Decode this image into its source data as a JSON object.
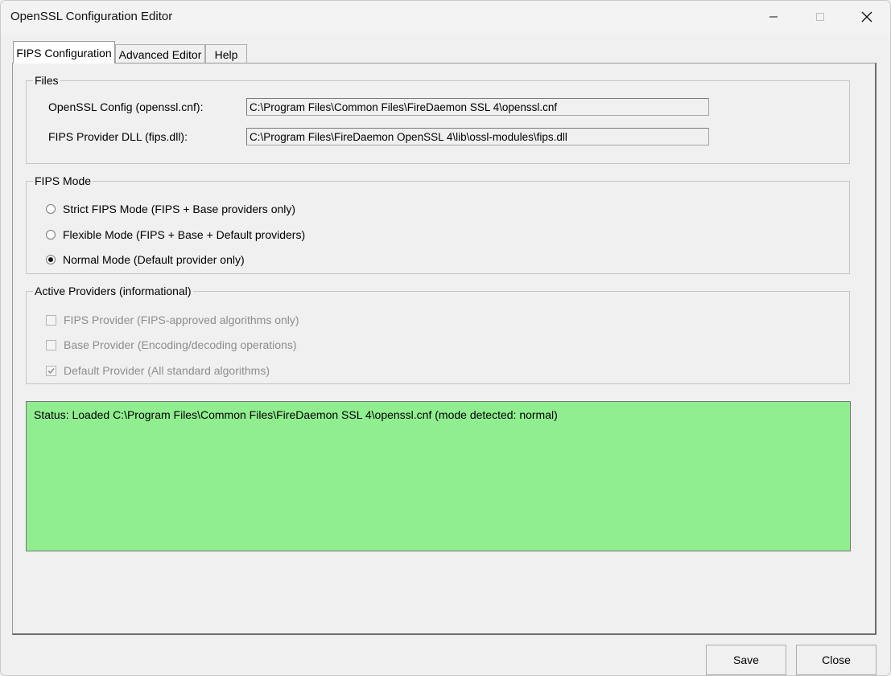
{
  "window": {
    "title": "OpenSSL Configuration Editor",
    "minimize_icon": "minimize-icon",
    "maximize_icon": "maximize-icon",
    "close_icon": "close-icon"
  },
  "tabs": [
    {
      "label": "FIPS Configuration",
      "active": true
    },
    {
      "label": "Advanced Editor",
      "active": false
    },
    {
      "label": "Help",
      "active": false
    }
  ],
  "files": {
    "title": "Files",
    "openssl_config_label": "OpenSSL Config (openssl.cnf):",
    "openssl_config_value": "C:\\Program Files\\Common Files\\FireDaemon SSL 4\\openssl.cnf",
    "fips_dll_label": "FIPS Provider DLL (fips.dll):",
    "fips_dll_value": "C:\\Program Files\\FireDaemon OpenSSL 4\\lib\\ossl-modules\\fips.dll"
  },
  "fips_mode": {
    "title": "FIPS Mode",
    "options": [
      {
        "label": "Strict FIPS Mode (FIPS + Base providers only)",
        "selected": false
      },
      {
        "label": "Flexible Mode (FIPS + Base + Default providers)",
        "selected": false
      },
      {
        "label": "Normal Mode (Default provider only)",
        "selected": true
      }
    ]
  },
  "active_providers": {
    "title": "Active Providers (informational)",
    "items": [
      {
        "label": "FIPS Provider (FIPS-approved algorithms only)",
        "checked": false,
        "enabled": false
      },
      {
        "label": "Base Provider (Encoding/decoding operations)",
        "checked": false,
        "enabled": false
      },
      {
        "label": "Default Provider (All standard algorithms)",
        "checked": true,
        "enabled": false
      }
    ]
  },
  "status": {
    "text": "Status: Loaded C:\\Program Files\\Common Files\\FireDaemon SSL 4\\openssl.cnf (mode detected: normal)",
    "background": "#90ee90"
  },
  "buttons": {
    "save_label": "Save",
    "close_label": "Close"
  }
}
